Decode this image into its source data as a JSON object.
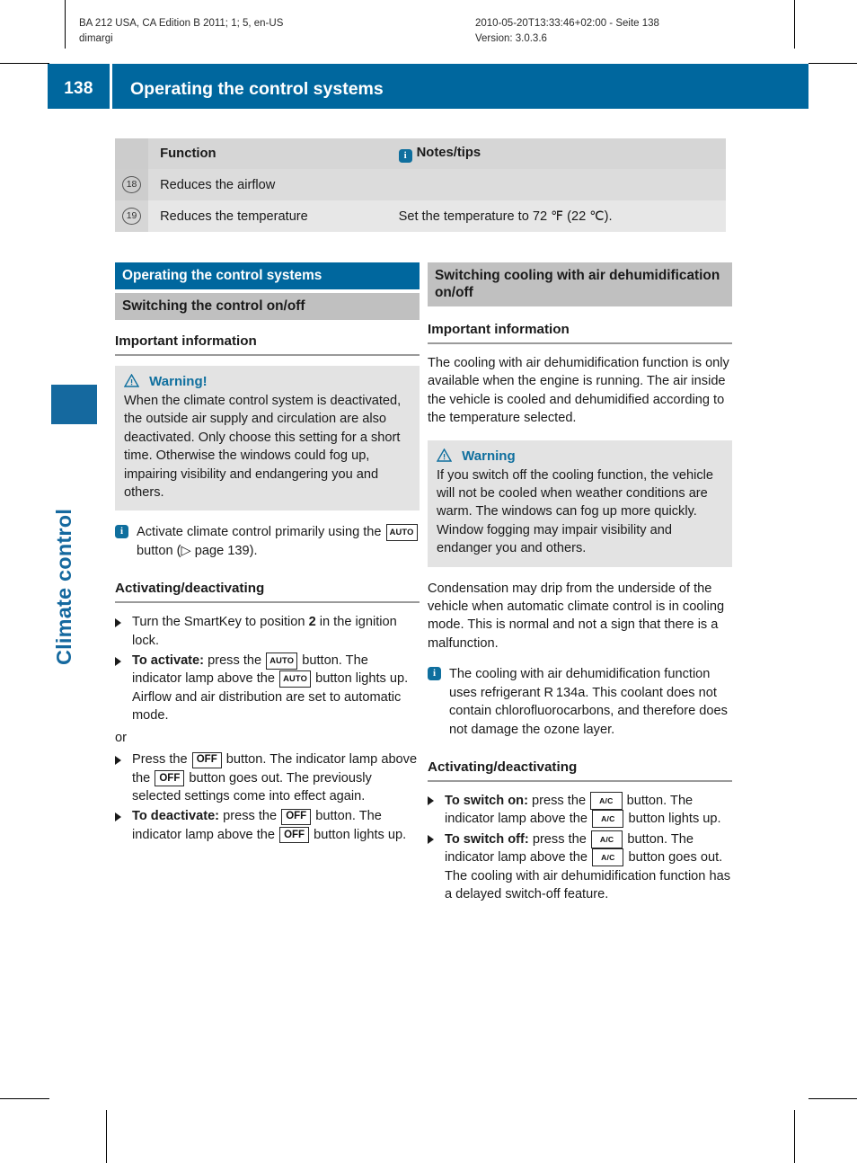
{
  "print_header": {
    "left": "BA 212 USA, CA Edition B 2011; 1; 5, en-US\ndimargi",
    "right": "2010-05-20T13:33:46+02:00 - Seite 138\nVersion: 3.0.3.6"
  },
  "page": {
    "number": "138",
    "running_title": "Operating the control systems",
    "chapter_tab": "Climate control",
    "accent_color": "#00679e",
    "gray_heading_color": "#c0c0c0",
    "warning_box_color": "#e3e3e3"
  },
  "table": {
    "headers": [
      "",
      "Function",
      "Notes/tips"
    ],
    "header_icon": "info-icon",
    "rows": [
      {
        "num": "18",
        "function": "Reduces the airflow",
        "notes": ""
      },
      {
        "num": "19",
        "function": "Reduces the temperature",
        "notes": "Set the temperature to 72 ℉ (22 ℃)."
      }
    ]
  },
  "left_column": {
    "section_heading": "Operating the control systems",
    "sub_heading": "Switching the control on/off",
    "important_information": "Important information",
    "warning": {
      "icon": "warning-triangle-icon",
      "title": "Warning!",
      "body": "When the climate control system is deactivated, the outside air supply and circulation are also deactivated. Only choose this setting for a short time. Otherwise the windows could fog up, impairing visibility and endangering you and others."
    },
    "note": {
      "icon": "info-icon",
      "text_before": "Activate climate control primarily using the",
      "button": "AUTO",
      "text_after": "button (▷ page 139)."
    },
    "activating_heading": "Activating/deactivating",
    "steps": [
      {
        "bold": "",
        "text_parts": [
          "Turn the SmartKey to position ",
          "2",
          " in the ignition lock."
        ]
      },
      {
        "bold": "To activate:",
        "text_parts": [
          "press the ",
          "AUTO",
          " button. The indicator lamp above the ",
          "AUTO",
          " button lights up. Airflow and air distribution are set to automatic mode."
        ]
      }
    ],
    "or_text": "or",
    "steps2": [
      {
        "bold": "",
        "text_parts": [
          "Press the ",
          "OFF",
          " button. The indicator lamp above the ",
          "OFF",
          " button goes out. The previously selected settings come into effect again."
        ]
      },
      {
        "bold": "To deactivate:",
        "text_parts": [
          "press the ",
          "OFF",
          " button. The indicator lamp above the ",
          "OFF",
          " button lights up."
        ]
      }
    ],
    "step1_a": "Turn the SmartKey to position",
    "step1_bold": "2",
    "step1_b": "in the ignition lock.",
    "step2_bold": "To activate:",
    "step2_a": "press the",
    "step2_btn": "AUTO",
    "step2_b": "button.",
    "step2_c": "The indicator lamp above the",
    "step2_d": "button lights up. Airflow and air distribution are set to automatic mode.",
    "step3_a": "Press the",
    "step3_btn": "OFF",
    "step3_b": "button.",
    "step3_c": "The indicator lamp above the",
    "step3_d": "button goes out. The previously selected settings come into effect again.",
    "step4_bold": "To deactivate:",
    "step4_a": "press the",
    "step4_b": "button.",
    "step4_c": "The indicator lamp above the",
    "step4_d": "button lights up."
  },
  "right_column": {
    "sub_heading": "Switching cooling with air dehumidification on/off",
    "important_information": "Important information",
    "paragraph1": "The cooling with air dehumidification function is only available when the engine is running. The air inside the vehicle is cooled and dehumidified according to the temperature selected.",
    "warning": {
      "icon": "warning-triangle-icon",
      "title": "Warning",
      "body": "If you switch off the cooling function, the vehicle will not be cooled when weather conditions are warm. The windows can fog up more quickly. Window fogging may impair visibility and endanger you and others."
    },
    "paragraph2": "Condensation may drip from the underside of the vehicle when automatic climate control is in cooling mode. This is normal and not a sign that there is a malfunction.",
    "note": {
      "icon": "info-icon",
      "text": "The cooling with air dehumidification function uses refrigerant R 134a. This coolant does not contain chlorofluorocarbons, and therefore does not damage the ozone layer."
    },
    "activating_heading": "Activating/deactivating",
    "step1_bold": "To switch on:",
    "step1_a": "press the",
    "step1_btn": "A/C",
    "step1_b": "button.",
    "step1_c": "The indicator lamp above the",
    "step1_d": "button lights up.",
    "step2_bold": "To switch off:",
    "step2_a": "press the",
    "step2_b": "button.",
    "step2_c": "The indicator lamp above the",
    "step2_d": "button goes out. The cooling with air dehumidification function has a delayed switch-off feature."
  }
}
